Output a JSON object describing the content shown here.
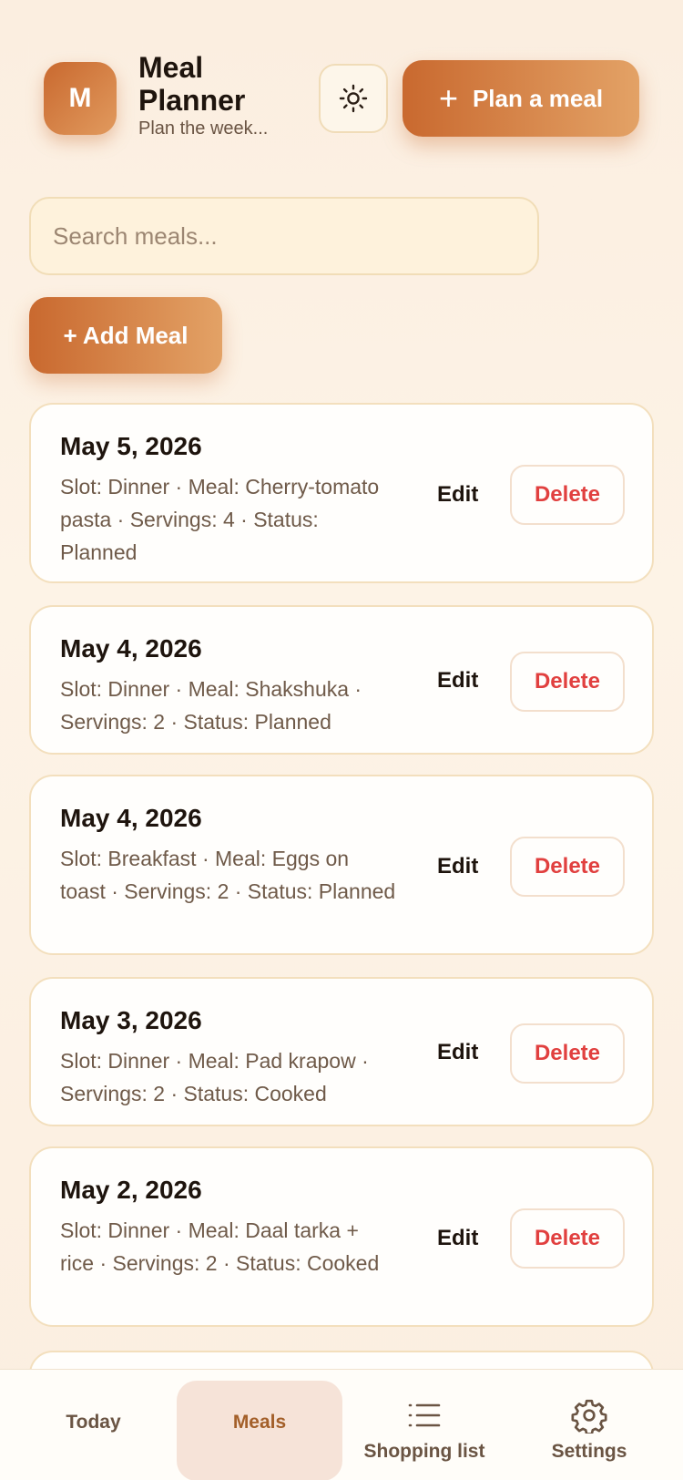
{
  "app": {
    "logo_letter": "M",
    "title": "Meal Planner",
    "subtitle": "Plan the week..."
  },
  "header": {
    "theme_icon": "sun-icon",
    "plan_button_label": "Plan a meal"
  },
  "search": {
    "placeholder": "Search meals..."
  },
  "actions": {
    "add_meal_label": "+ Add Meal"
  },
  "meals": [
    {
      "date": "May 5, 2026",
      "meta": "Slot: Dinner · Meal: Cherry-tomato pasta · Servings: 4 · Status: Planned",
      "edit": "Edit",
      "delete": "Delete"
    },
    {
      "date": "May 4, 2026",
      "meta": "Slot: Dinner · Meal: Shakshuka · Servings: 2 · Status: Planned",
      "edit": "Edit",
      "delete": "Delete"
    },
    {
      "date": "May 4, 2026",
      "meta": "Slot: Breakfast · Meal: Eggs on toast · Servings: 2 · Status: Planned",
      "edit": "Edit",
      "delete": "Delete"
    },
    {
      "date": "May 3, 2026",
      "meta": "Slot: Dinner · Meal: Pad krapow · Servings: 2 · Status: Cooked",
      "edit": "Edit",
      "delete": "Delete"
    },
    {
      "date": "May 2, 2026",
      "meta": "Slot: Dinner · Meal: Daal tarka + rice · Servings: 2 · Status: Cooked",
      "edit": "Edit",
      "delete": "Delete"
    }
  ],
  "nav": {
    "today": "Today",
    "meals": "Meals",
    "shopping": "Shopping list",
    "settings": "Settings"
  },
  "colors": {
    "accent": "#c9692f",
    "delete": "#e1403f",
    "active_tab_bg": "#f6e3d8"
  }
}
